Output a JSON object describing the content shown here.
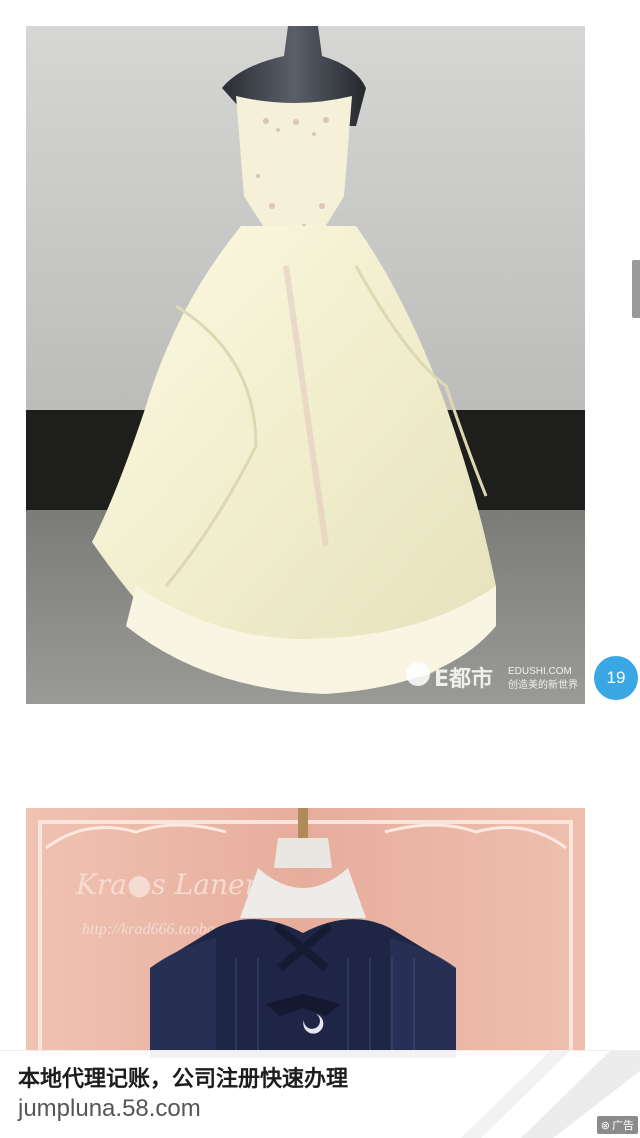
{
  "feed": {
    "images": [
      {
        "name": "white-gown-photo",
        "watermark_brand": "E都市",
        "watermark_site": "EDUSHI.COM",
        "watermark_slogan": "创造美的新世界"
      },
      {
        "name": "navy-dress-photo",
        "watermark_brand": "Kra●s Lanere",
        "watermark_url": "http://krad666.taobao.com"
      }
    ],
    "page_badge": "19"
  },
  "ad": {
    "title": "本地代理记账，公司注册快速办理",
    "url": "jumpluna.58.com",
    "tag_icon": "close-icon",
    "tag_label": "广告"
  },
  "colors": {
    "badge": "#39a7e3",
    "ad_tag_bg": "#8b8b8b",
    "wall": "#c9c9c7",
    "gown": "#f3f0d2",
    "dress_backdrop": "#eab5a5",
    "dress": "#1f2544"
  }
}
